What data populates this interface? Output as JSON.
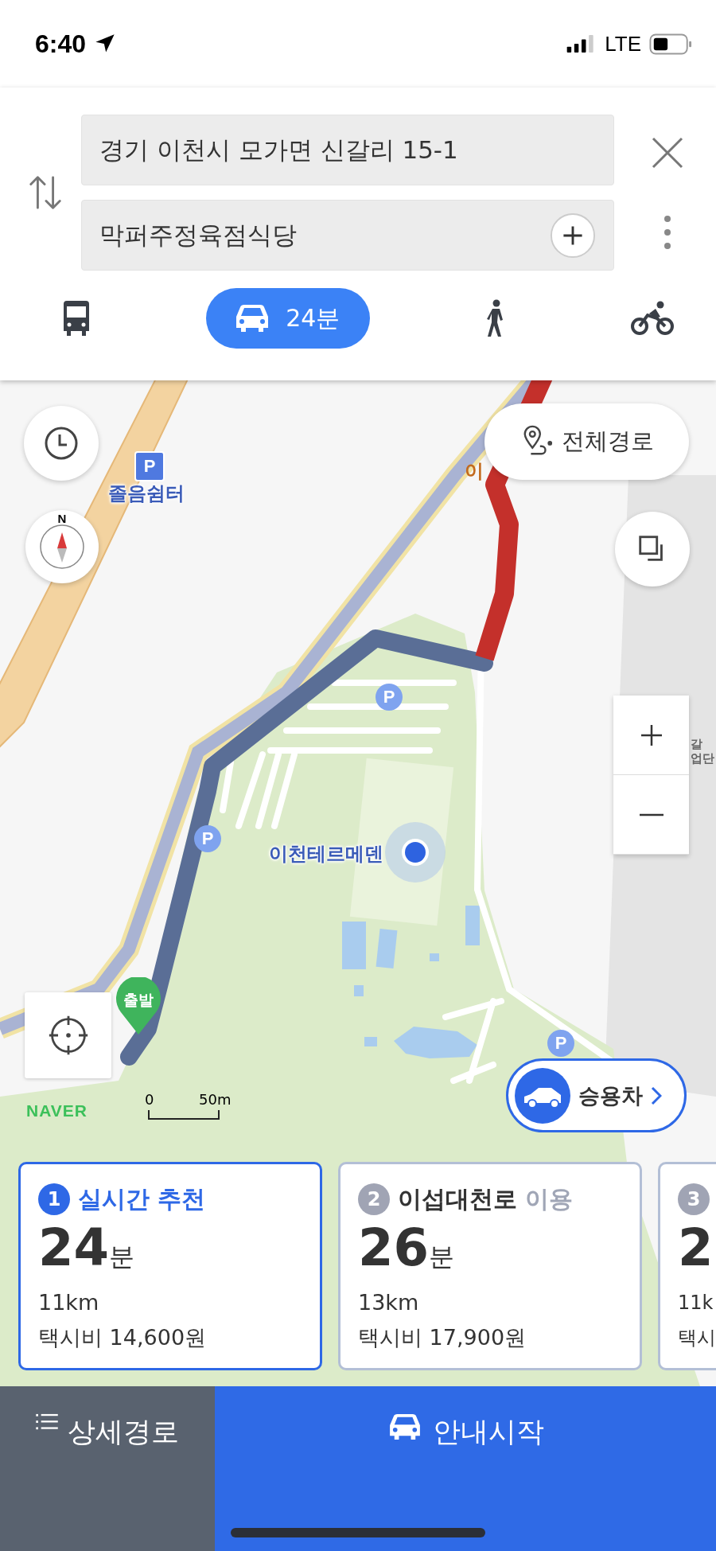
{
  "status_bar": {
    "time": "6:40",
    "network": "LTE"
  },
  "route_search": {
    "origin": "경기 이천시 모가면 신갈리 15-1",
    "destination": "막퍼주정육점식당"
  },
  "transport_modes": [
    {
      "kind": "bus",
      "selected": false
    },
    {
      "kind": "car",
      "label": "24분",
      "selected": true
    },
    {
      "kind": "walk",
      "selected": false
    },
    {
      "kind": "bike",
      "selected": false
    }
  ],
  "map": {
    "full_route_button": "전체경로",
    "compass_label": "N",
    "rest_area_label": "졸음쉼터",
    "spa_label": "이천테르메덴",
    "road_label": "이",
    "building_label": [
      "갈",
      "업단"
    ],
    "start_marker": "출발",
    "scale": {
      "start": "0",
      "end": "50m"
    },
    "logo": "NAVER",
    "vehicle_button": "승용차",
    "parking_markers": [
      {
        "kind": "square",
        "text": "P"
      },
      {
        "kind": "round",
        "text": "P"
      },
      {
        "kind": "round",
        "text": "P"
      },
      {
        "kind": "round",
        "text": "P"
      }
    ]
  },
  "routes": [
    {
      "number": "1",
      "title": "실시간 추천",
      "selected": true,
      "minutes": "24",
      "unit": "분",
      "distance": "11km",
      "fare": "택시비 14,600원"
    },
    {
      "number": "2",
      "title": "이섭대천로",
      "suffix": "이용",
      "selected": false,
      "minutes": "26",
      "unit": "분",
      "distance": "13km",
      "fare": "택시비 17,900원"
    },
    {
      "number": "3",
      "selected": false,
      "minutes": "2",
      "distance": "11k",
      "fare": "택시"
    }
  ],
  "bottom_buttons": [
    {
      "kind": "details",
      "label": "상세경로"
    },
    {
      "kind": "start",
      "label": "안내시작"
    }
  ]
}
